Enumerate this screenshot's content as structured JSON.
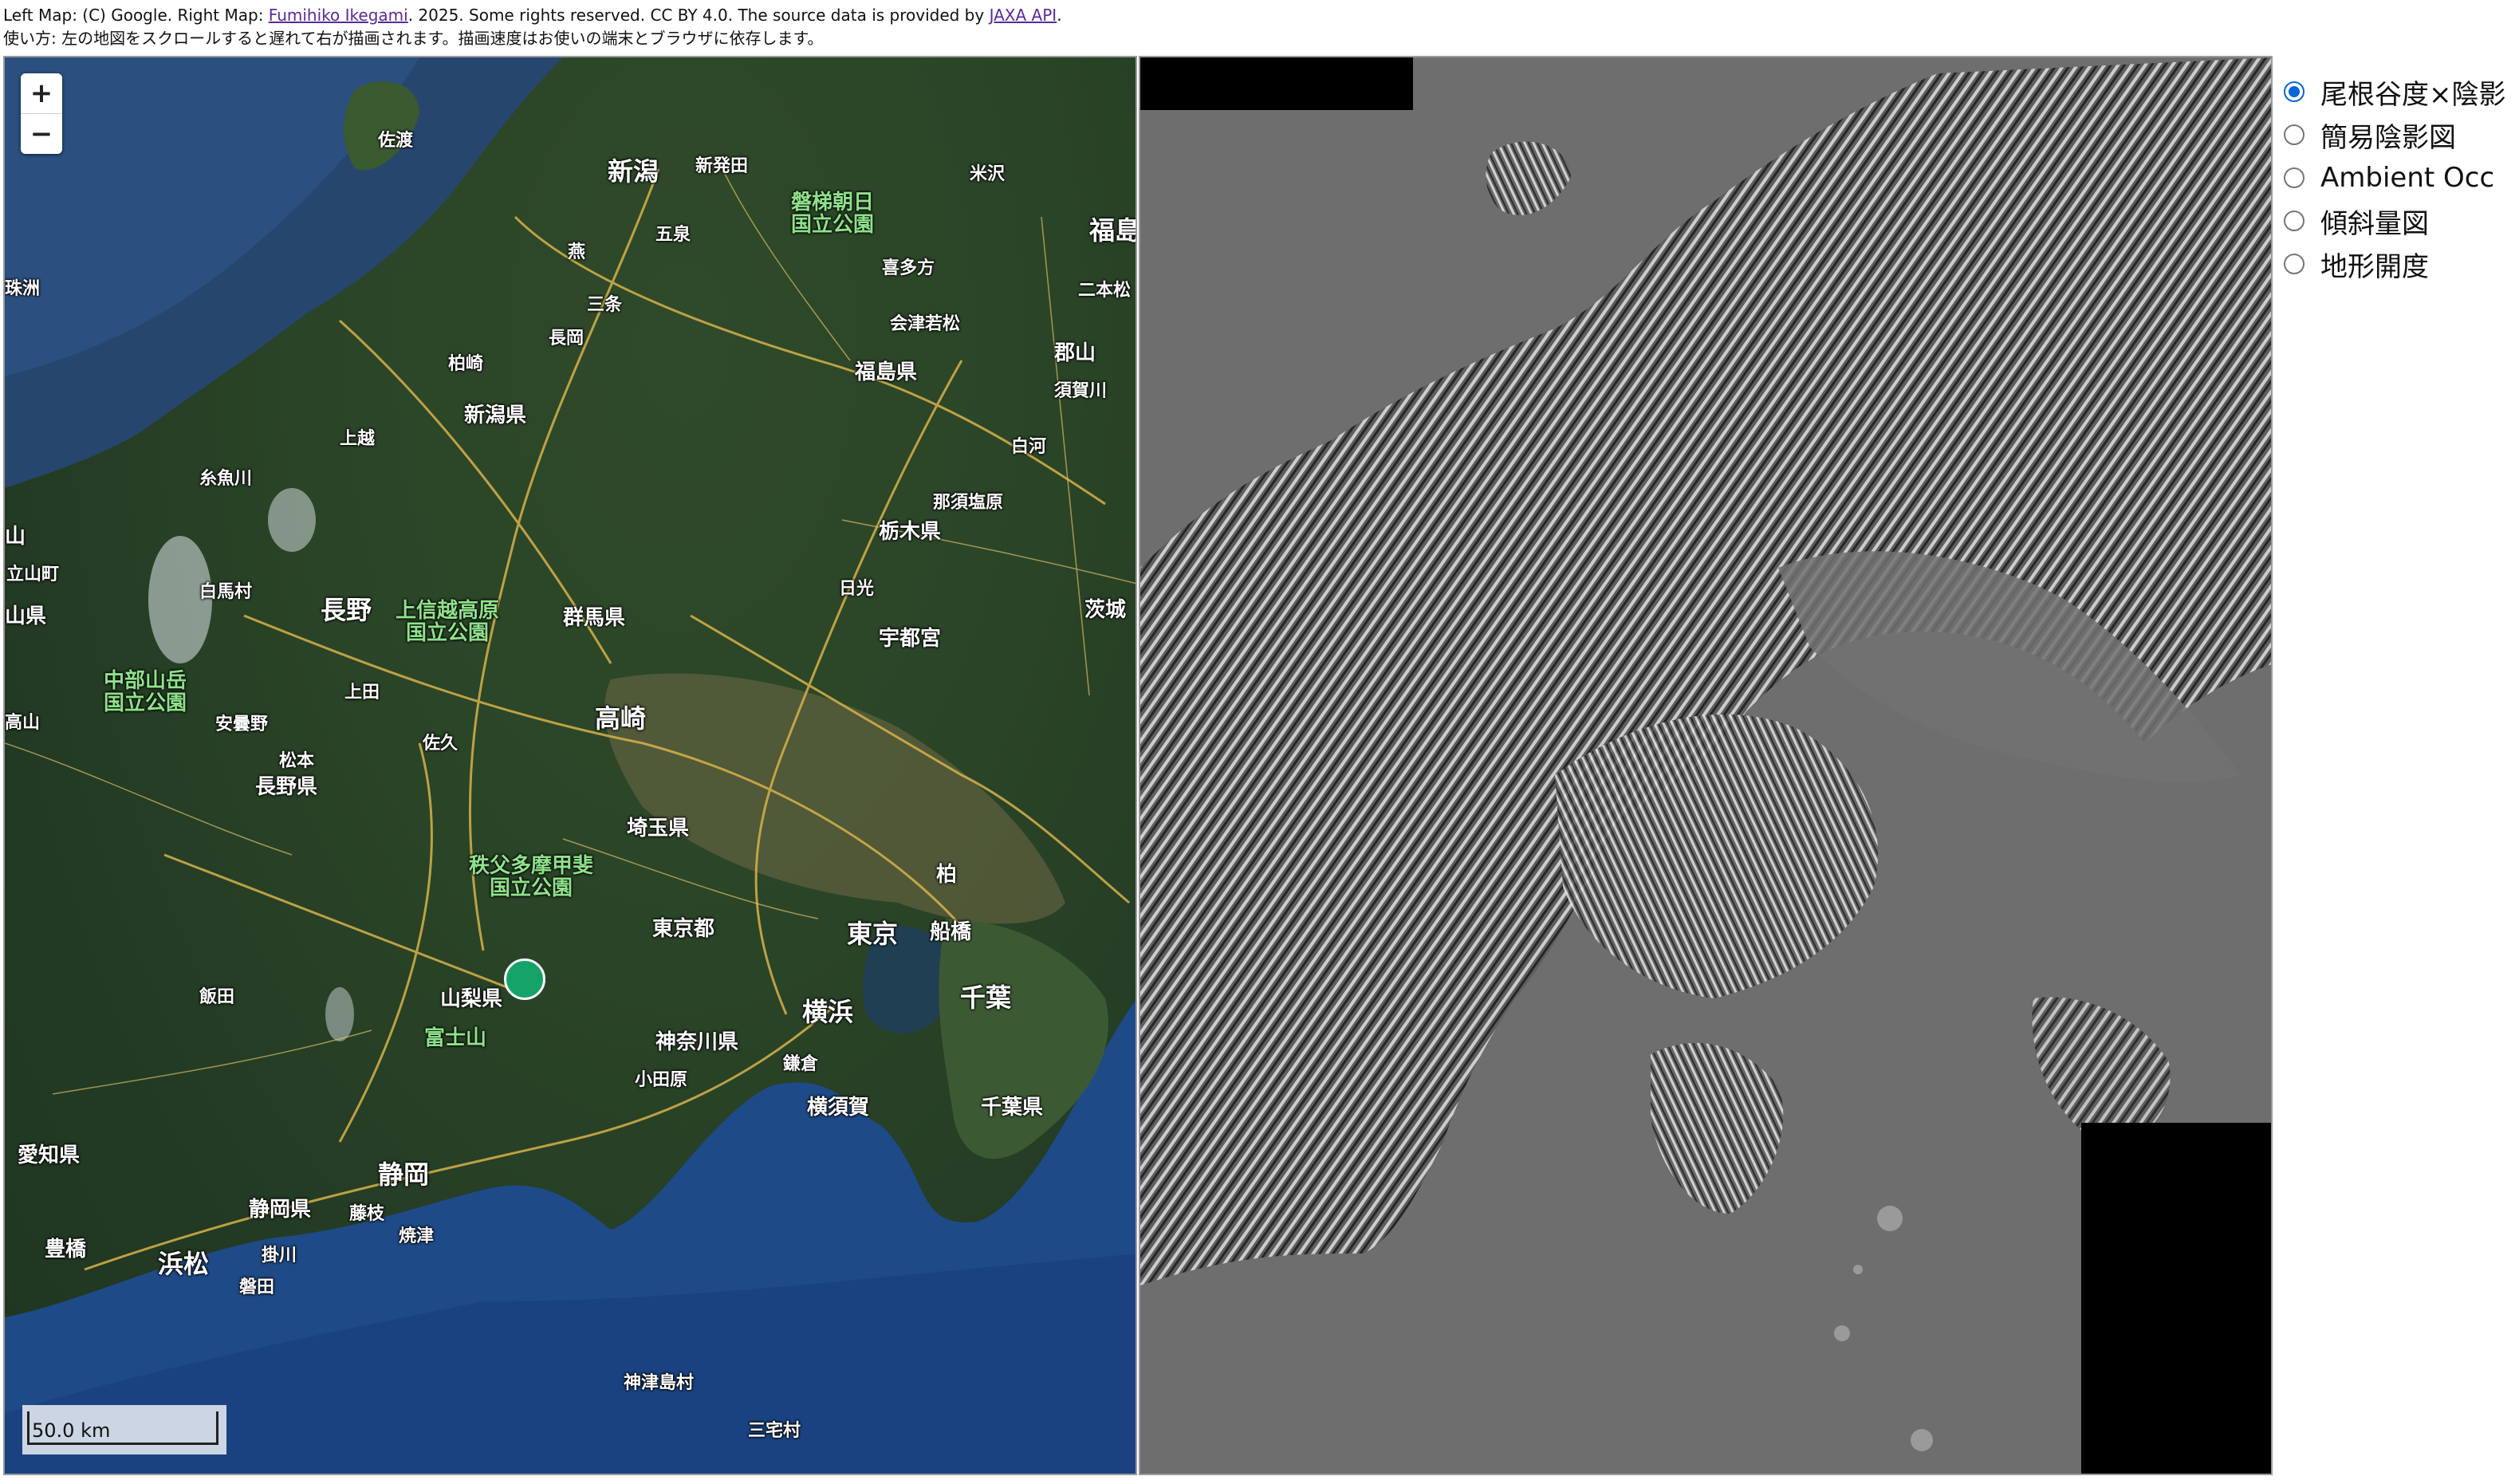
{
  "credit": {
    "prefix": "Left Map: (C) Google. Right Map: ",
    "author_link": "Fumihiko Ikegami",
    "middle": ". 2025. Some rights reserved. CC BY 4.0. The source data is provided by ",
    "jaxa_link": "JAXA API",
    "suffix": "."
  },
  "usage": "使い方: 左の地図をスクロールすると遅れて右が描画されます。描画速度はお使いの端末とブラウザに依存します。",
  "left_map": {
    "zoom_in": "+",
    "zoom_out": "−",
    "scale_label": "50.0 km",
    "labels": {
      "sado": "佐渡",
      "niigata": "新潟",
      "shinhotta": "新発田",
      "gosen": "五泉",
      "bandai": "磐梯朝日\n国立公園",
      "yonezawa": "米沢",
      "fukushima": "福島",
      "nihonmatsu": "二本松",
      "kitakata": "喜多方",
      "aizuwakamatsu": "会津若松",
      "koriyama": "郡山",
      "sukagawa": "須賀川",
      "fukushima_ken": "福島県",
      "shirakawa": "白河",
      "nasushiobara": "那須塩原",
      "tochigi_ken": "栃木県",
      "nikko": "日光",
      "utsunomiya": "宇都宮",
      "ibaraki": "茨城",
      "sanjo": "三条",
      "nagaoka": "長岡",
      "tsubame": "燕",
      "kashiwazaki": "柏崎",
      "niigata_ken": "新潟県",
      "joetsu": "上越",
      "itoigawa": "糸魚川",
      "hakuba": "白馬村",
      "nagano": "長野",
      "joshinetsu": "上信越高原\n国立公園",
      "gunma_ken": "群馬県",
      "chubusangaku": "中部山岳\n国立公園",
      "azumino": "安曇野",
      "ueda": "上田",
      "matsumoto": "松本",
      "saku": "佐久",
      "takasaki": "高崎",
      "nagano_ken": "長野県",
      "saitama_ken": "埼玉県",
      "chichibu": "秩父多摩甲斐\n国立公園",
      "kashiwa": "柏",
      "tokyo_to": "東京都",
      "tokyo": "東京",
      "funabashi": "船橋",
      "iida": "飯田",
      "yamanashi_ken": "山梨県",
      "fujisan": "富士山",
      "kanagawa_ken": "神奈川県",
      "yokohama": "横浜",
      "chiba": "千葉",
      "odawara": "小田原",
      "kamakura": "鎌倉",
      "yokosuka": "横須賀",
      "chiba_ken": "千葉県",
      "aichi_ken": "愛知県",
      "shizuoka": "静岡",
      "shizuoka_ken": "静岡県",
      "fujieda": "藤枝",
      "yaizu": "焼津",
      "toyohashi": "豊橋",
      "hamamatsu": "浜松",
      "kakegawa": "掛川",
      "iwata": "磐田",
      "kozushima": "神津島村",
      "miyake": "三宅村",
      "tateyama": "立山町",
      "toyama_ken": "山県",
      "takayama": "高山",
      "ishikawa": "珠洲",
      "san": "山"
    }
  },
  "layers": {
    "items": [
      {
        "label": "尾根谷度×陰影",
        "checked": true
      },
      {
        "label": "簡易陰影図",
        "checked": false
      },
      {
        "label": "Ambient Occ",
        "checked": false
      },
      {
        "label": "傾斜量図",
        "checked": false
      },
      {
        "label": "地形開度",
        "checked": false
      }
    ]
  }
}
